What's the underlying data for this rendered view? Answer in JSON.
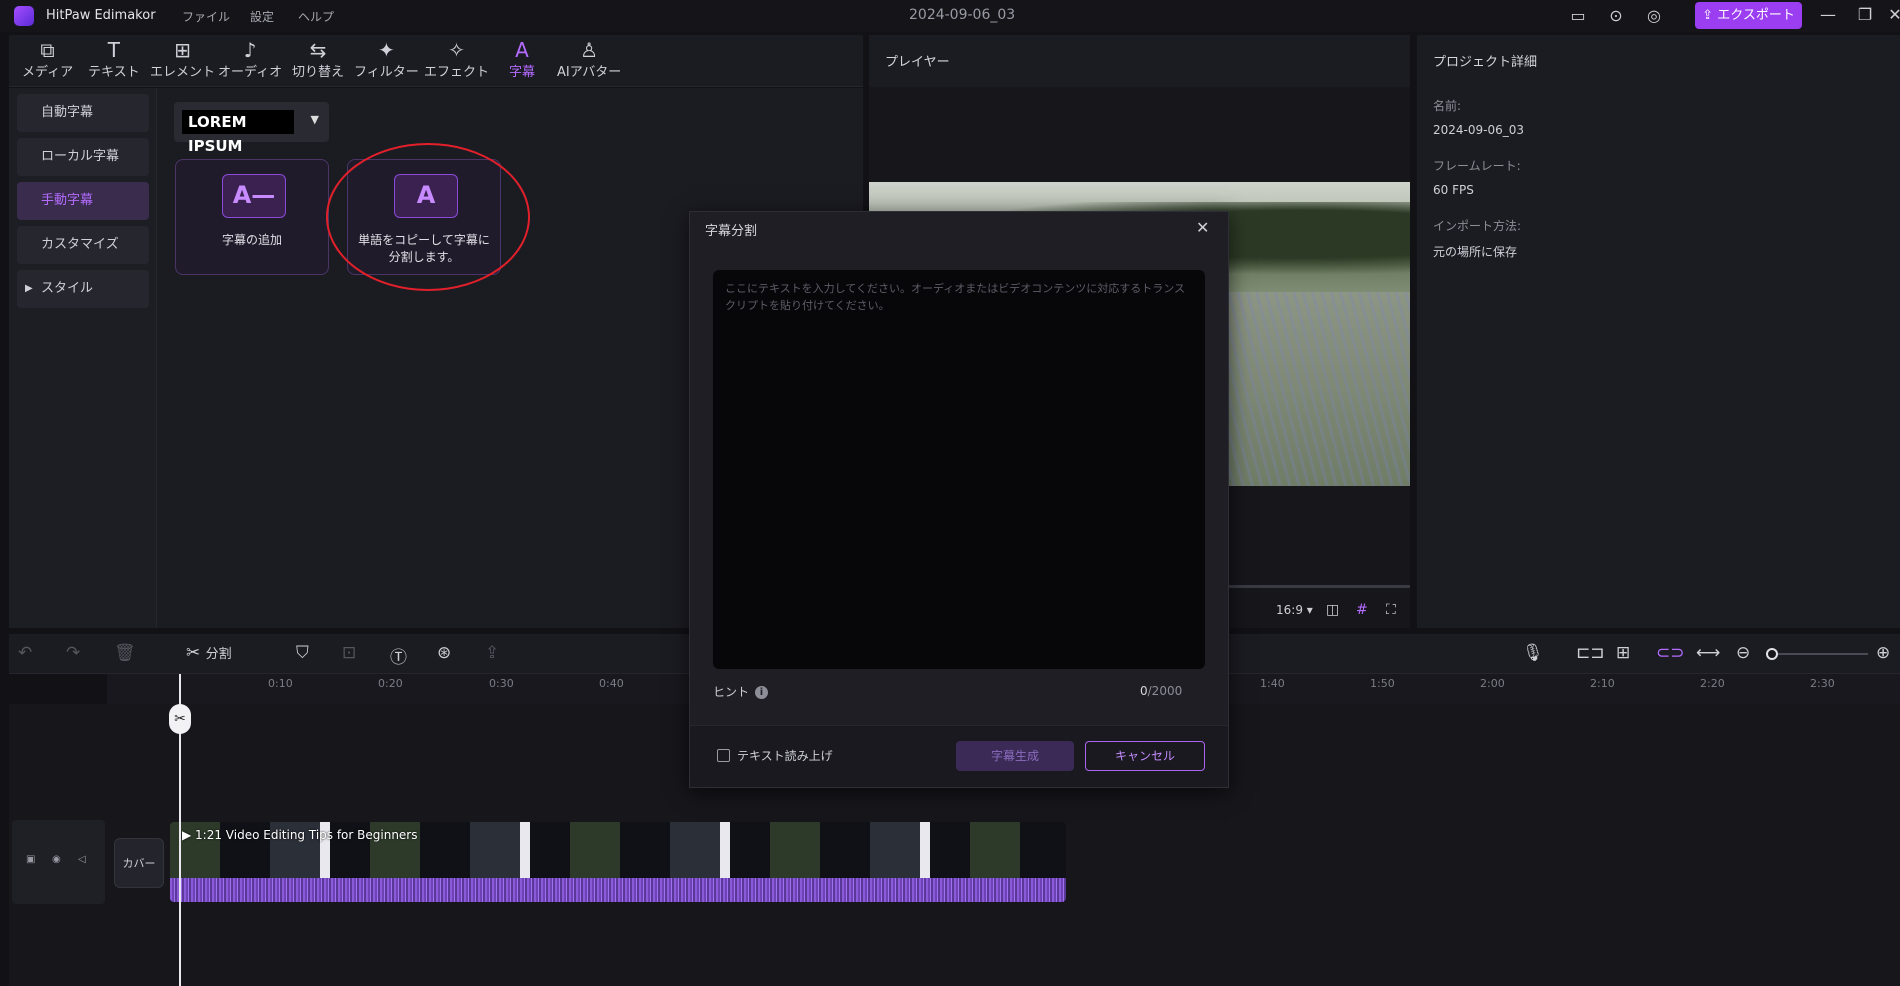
{
  "app": {
    "name": "HitPaw Edimakor",
    "menu": [
      "ファイル",
      "設定",
      "ヘルプ"
    ],
    "project_title": "2024-09-06_03",
    "export_label": "エクスポート"
  },
  "toolbar": {
    "items": [
      {
        "label": "メディア",
        "icon": "media-icon"
      },
      {
        "label": "テキスト",
        "icon": "text-icon"
      },
      {
        "label": "エレメント",
        "icon": "element-icon"
      },
      {
        "label": "オーディオ",
        "icon": "audio-icon"
      },
      {
        "label": "切り替え",
        "icon": "transition-icon"
      },
      {
        "label": "フィルター",
        "icon": "filter-icon"
      },
      {
        "label": "エフェクト",
        "icon": "effect-icon"
      },
      {
        "label": "字幕",
        "icon": "subtitle-icon"
      },
      {
        "label": "AIアバター",
        "icon": "ai-avatar-icon"
      }
    ],
    "active": "字幕"
  },
  "sidebar": {
    "items": [
      "自動字幕",
      "ローカル字幕",
      "手動字幕",
      "カスタマイズ",
      "スタイル"
    ],
    "active": "手動字幕"
  },
  "subtitle_panel": {
    "font_preset": "LOREM IPSUM",
    "cards": [
      {
        "label": "字幕の追加",
        "icon_text": "A—"
      },
      {
        "label": "単語をコピーして字幕に分割します。",
        "icon_text": "A"
      }
    ]
  },
  "player": {
    "title": "プレイヤー",
    "aspect_ratio": "16:9"
  },
  "details": {
    "title": "プロジェクト詳細",
    "fields": [
      {
        "label": "名前:",
        "value": "2024-09-06_03"
      },
      {
        "label": "フレームレート:",
        "value": "60 FPS"
      },
      {
        "label": "インポート方法:",
        "value": "元の場所に保存"
      }
    ]
  },
  "timeline": {
    "split_label": "分割",
    "ruler_ticks": [
      "0:10",
      "0:20",
      "0:30",
      "0:40",
      "1:40",
      "1:50",
      "2:00",
      "2:10",
      "2:20",
      "2:30"
    ],
    "cover_label": "カバー",
    "clip_title": "1:21 Video Editing Tips for Beginners"
  },
  "modal": {
    "title": "字幕分割",
    "placeholder": "ここにテキストを入力してください。オーディオまたはビデオコンテンツに対応するトランスクリプトを貼り付けてください。",
    "hint_label": "ヒント",
    "char_count": "0",
    "char_limit": "/2000",
    "read_aloud_label": "テキスト読み上げ",
    "generate_label": "字幕生成",
    "cancel_label": "キャンセル"
  },
  "colors": {
    "accent": "#9b3df0",
    "highlight_annotation": "#e0202a"
  }
}
